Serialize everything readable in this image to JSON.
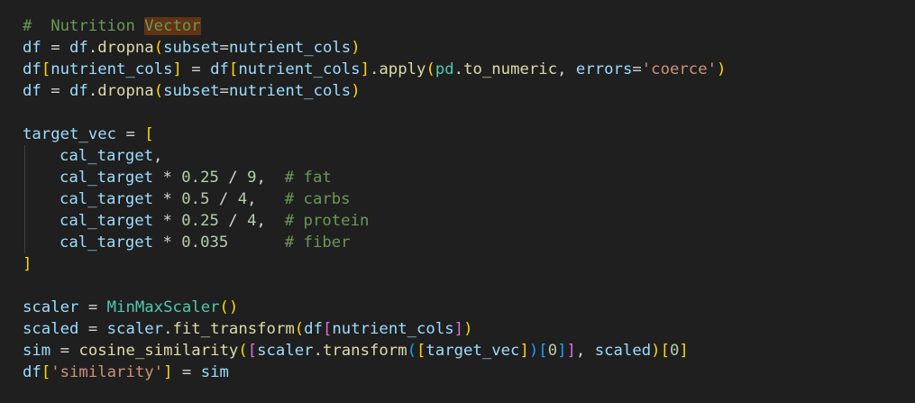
{
  "editor": {
    "lines": [
      [
        {
          "t": "#  Nutrition ",
          "c": "comment"
        },
        {
          "t": "Vector",
          "c": "comment",
          "hl": true
        }
      ],
      [
        {
          "t": "df",
          "c": "var"
        },
        {
          "t": " = ",
          "c": "op"
        },
        {
          "t": "df",
          "c": "var"
        },
        {
          "t": ".",
          "c": "op"
        },
        {
          "t": "dropna",
          "c": "fn"
        },
        {
          "t": "(",
          "c": "br1"
        },
        {
          "t": "subset",
          "c": "var"
        },
        {
          "t": "=",
          "c": "op"
        },
        {
          "t": "nutrient_cols",
          "c": "var"
        },
        {
          "t": ")",
          "c": "br1"
        }
      ],
      [
        {
          "t": "df",
          "c": "var"
        },
        {
          "t": "[",
          "c": "br1"
        },
        {
          "t": "nutrient_cols",
          "c": "var"
        },
        {
          "t": "]",
          "c": "br1"
        },
        {
          "t": " = ",
          "c": "op"
        },
        {
          "t": "df",
          "c": "var"
        },
        {
          "t": "[",
          "c": "br1"
        },
        {
          "t": "nutrient_cols",
          "c": "var"
        },
        {
          "t": "]",
          "c": "br1"
        },
        {
          "t": ".",
          "c": "op"
        },
        {
          "t": "apply",
          "c": "fn"
        },
        {
          "t": "(",
          "c": "br1"
        },
        {
          "t": "pd",
          "c": "cls"
        },
        {
          "t": ".",
          "c": "op"
        },
        {
          "t": "to_numeric",
          "c": "fn"
        },
        {
          "t": ", ",
          "c": "op"
        },
        {
          "t": "errors",
          "c": "var"
        },
        {
          "t": "=",
          "c": "op"
        },
        {
          "t": "'coerce'",
          "c": "str"
        },
        {
          "t": ")",
          "c": "br1"
        }
      ],
      [
        {
          "t": "df",
          "c": "var"
        },
        {
          "t": " = ",
          "c": "op"
        },
        {
          "t": "df",
          "c": "var"
        },
        {
          "t": ".",
          "c": "op"
        },
        {
          "t": "dropna",
          "c": "fn"
        },
        {
          "t": "(",
          "c": "br1"
        },
        {
          "t": "subset",
          "c": "var"
        },
        {
          "t": "=",
          "c": "op"
        },
        {
          "t": "nutrient_cols",
          "c": "var"
        },
        {
          "t": ")",
          "c": "br1"
        }
      ],
      [],
      [
        {
          "t": "target_vec",
          "c": "var"
        },
        {
          "t": " = ",
          "c": "op"
        },
        {
          "t": "[",
          "c": "br1"
        }
      ],
      {
        "indent": true,
        "tokens": [
          {
            "t": "cal_target",
            "c": "var"
          },
          {
            "t": ",",
            "c": "op"
          }
        ]
      },
      {
        "indent": true,
        "tokens": [
          {
            "t": "cal_target",
            "c": "var"
          },
          {
            "t": " * ",
            "c": "op"
          },
          {
            "t": "0.25",
            "c": "num"
          },
          {
            "t": " / ",
            "c": "op"
          },
          {
            "t": "9",
            "c": "num"
          },
          {
            "t": ",  ",
            "c": "op"
          },
          {
            "t": "# fat",
            "c": "comment"
          }
        ]
      },
      {
        "indent": true,
        "tokens": [
          {
            "t": "cal_target",
            "c": "var"
          },
          {
            "t": " * ",
            "c": "op"
          },
          {
            "t": "0.5",
            "c": "num"
          },
          {
            "t": " / ",
            "c": "op"
          },
          {
            "t": "4",
            "c": "num"
          },
          {
            "t": ",   ",
            "c": "op"
          },
          {
            "t": "# carbs",
            "c": "comment"
          }
        ]
      },
      {
        "indent": true,
        "tokens": [
          {
            "t": "cal_target",
            "c": "var"
          },
          {
            "t": " * ",
            "c": "op"
          },
          {
            "t": "0.25",
            "c": "num"
          },
          {
            "t": " / ",
            "c": "op"
          },
          {
            "t": "4",
            "c": "num"
          },
          {
            "t": ",  ",
            "c": "op"
          },
          {
            "t": "# protein",
            "c": "comment"
          }
        ]
      },
      {
        "indent": true,
        "tokens": [
          {
            "t": "cal_target",
            "c": "var"
          },
          {
            "t": " * ",
            "c": "op"
          },
          {
            "t": "0.035",
            "c": "num"
          },
          {
            "t": "      ",
            "c": "op"
          },
          {
            "t": "# fiber",
            "c": "comment"
          }
        ]
      },
      [
        {
          "t": "]",
          "c": "br1"
        }
      ],
      [],
      [
        {
          "t": "scaler",
          "c": "var"
        },
        {
          "t": " = ",
          "c": "op"
        },
        {
          "t": "MinMaxScaler",
          "c": "cls"
        },
        {
          "t": "()",
          "c": "br1"
        }
      ],
      [
        {
          "t": "scaled",
          "c": "var"
        },
        {
          "t": " = ",
          "c": "op"
        },
        {
          "t": "scaler",
          "c": "var"
        },
        {
          "t": ".",
          "c": "op"
        },
        {
          "t": "fit_transform",
          "c": "fn"
        },
        {
          "t": "(",
          "c": "br1"
        },
        {
          "t": "df",
          "c": "var"
        },
        {
          "t": "[",
          "c": "br2"
        },
        {
          "t": "nutrient_cols",
          "c": "var"
        },
        {
          "t": "]",
          "c": "br2"
        },
        {
          "t": ")",
          "c": "br1"
        }
      ],
      [
        {
          "t": "sim",
          "c": "var"
        },
        {
          "t": " = ",
          "c": "op"
        },
        {
          "t": "cosine_similarity",
          "c": "fn"
        },
        {
          "t": "(",
          "c": "br1"
        },
        {
          "t": "[",
          "c": "br2"
        },
        {
          "t": "scaler",
          "c": "var"
        },
        {
          "t": ".",
          "c": "op"
        },
        {
          "t": "transform",
          "c": "fn"
        },
        {
          "t": "(",
          "c": "br3"
        },
        {
          "t": "[",
          "c": "br1"
        },
        {
          "t": "target_vec",
          "c": "var"
        },
        {
          "t": "]",
          "c": "br1"
        },
        {
          "t": ")",
          "c": "br3"
        },
        {
          "t": "[",
          "c": "br3"
        },
        {
          "t": "0",
          "c": "num"
        },
        {
          "t": "]",
          "c": "br3"
        },
        {
          "t": "]",
          "c": "br2"
        },
        {
          "t": ", ",
          "c": "op"
        },
        {
          "t": "scaled",
          "c": "var"
        },
        {
          "t": ")",
          "c": "br1"
        },
        {
          "t": "[",
          "c": "br1"
        },
        {
          "t": "0",
          "c": "num"
        },
        {
          "t": "]",
          "c": "br1"
        }
      ],
      [
        {
          "t": "df",
          "c": "var"
        },
        {
          "t": "[",
          "c": "br1"
        },
        {
          "t": "'similarity'",
          "c": "str"
        },
        {
          "t": "]",
          "c": "br1"
        },
        {
          "t": " = ",
          "c": "op"
        },
        {
          "t": "sim",
          "c": "var"
        }
      ]
    ]
  },
  "colors": {
    "background": "#1f1f1f",
    "comment": "#6a9955",
    "variable": "#9cdcfe",
    "function": "#dcdcaa",
    "class": "#4ec9b0",
    "string": "#ce9178",
    "number": "#b5cea8",
    "bracket_level1": "#ffd700",
    "bracket_level2": "#da70d6",
    "bracket_level3": "#179fff",
    "find_highlight": "#613214"
  }
}
